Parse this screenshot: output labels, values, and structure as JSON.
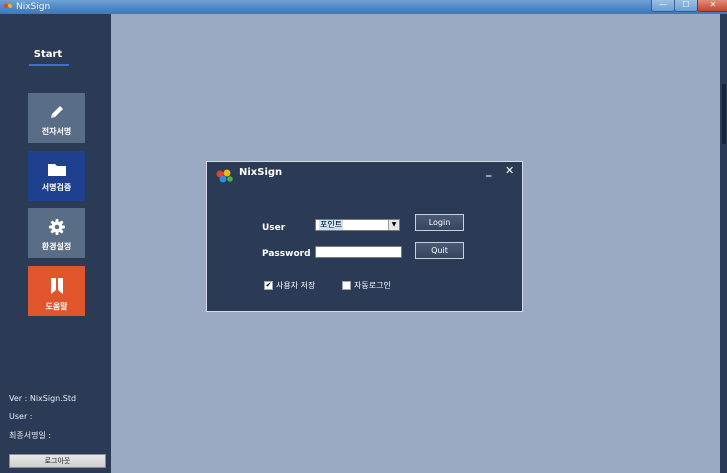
{
  "window": {
    "title": "NixSign",
    "controls": {
      "minimize": "—",
      "maximize": "☐",
      "close": "✕"
    }
  },
  "sidebar": {
    "start_label": "Start",
    "tiles": [
      {
        "label": "전자서명",
        "icon": "pencil-icon",
        "color": "#5a6d86"
      },
      {
        "label": "서명검증",
        "icon": "folder-icon",
        "color": "#1f3f8f"
      },
      {
        "label": "환경설정",
        "icon": "gear-icon",
        "color": "#5a6d86"
      },
      {
        "label": "도움말",
        "icon": "book-icon",
        "color": "#e0552c"
      }
    ],
    "info": {
      "version": "Ver  : NixSign.Std",
      "user": "User :",
      "last_signed": "최종서명일 :"
    },
    "logout_label": "로그아웃"
  },
  "dialog": {
    "title": "NixSign",
    "minimize": "_",
    "close": "✕",
    "user_label": "User",
    "user_selected": "포인트",
    "password_label": "Password",
    "password_value": "",
    "login_button": "Login",
    "quit_button": "Quit",
    "save_user_label": "사용자 저장",
    "save_user_checked": true,
    "auto_login_label": "자동로그인",
    "auto_login_checked": false
  },
  "colors": {
    "sidebar_bg": "#2b3a55",
    "main_bg": "#9aaac3",
    "accent_blue": "#1f3f8f",
    "help_orange": "#e0552c"
  }
}
